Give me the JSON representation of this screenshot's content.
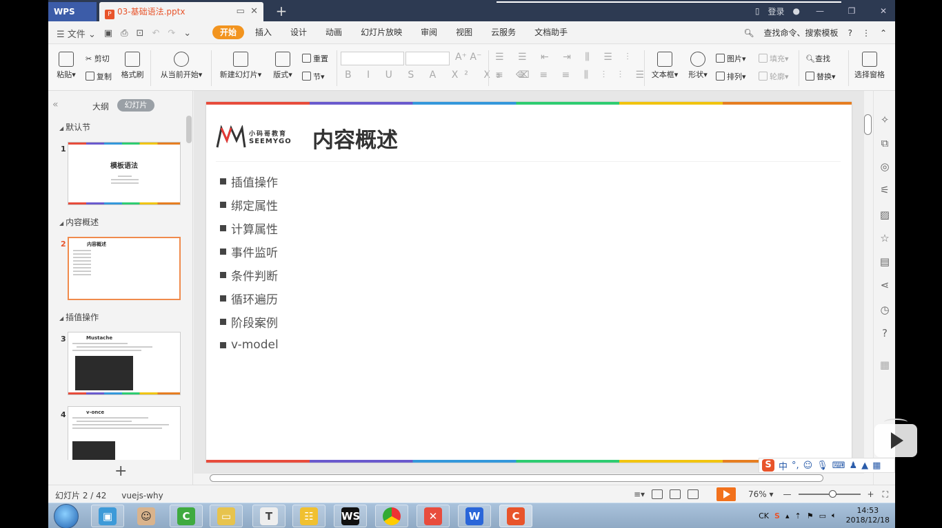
{
  "titlebar": {
    "app_tab": "WPS",
    "doc_tab": "03-基础语法.pptx",
    "new_tab": "+",
    "login": "登录"
  },
  "menubar": {
    "file": "文件",
    "tabs": [
      "开始",
      "插入",
      "设计",
      "动画",
      "幻灯片放映",
      "审阅",
      "视图",
      "云服务",
      "文档助手"
    ],
    "search": "查找命令、搜索模板"
  },
  "ribbon": {
    "paste": "粘贴",
    "cut": "剪切",
    "copy": "复制",
    "format_painter": "格式刷",
    "from_current": "从当前开始",
    "new_slide": "新建幻灯片",
    "layout": "版式",
    "reset": "重置",
    "section": "节",
    "textbox": "文本框",
    "shape": "形状",
    "picture": "图片",
    "arrange": "排列",
    "fill": "填充",
    "outline": "轮廓",
    "find": "查找",
    "replace": "替换",
    "select_pane": "选择窗格"
  },
  "leftpanel": {
    "outline_tab": "大纲",
    "slides_tab": "幻灯片",
    "sections": [
      {
        "label": "默认节"
      },
      {
        "label": "内容概述"
      },
      {
        "label": "插值操作"
      }
    ],
    "thumbs": [
      {
        "num": "1",
        "title": "模板语法"
      },
      {
        "num": "2",
        "title": "内容概述"
      },
      {
        "num": "3",
        "title": "Mustache"
      },
      {
        "num": "4",
        "title": "v-once"
      }
    ],
    "add": "+"
  },
  "slide": {
    "logo_cn": "小码哥教育",
    "logo_en": "SEEMYGO",
    "title": "内容概述",
    "bullets": [
      "插值操作",
      "绑定属性",
      "计算属性",
      "事件监听",
      "条件判断",
      "循环遍历",
      "阶段案例",
      "v-model"
    ]
  },
  "ime": {
    "lang": "中"
  },
  "statusbar": {
    "slide_pos": "幻灯片 2 / 42",
    "theme": "vuejs-why",
    "zoom": "76%"
  },
  "taskbar": {
    "tray_lang": "CK",
    "time": "14:53",
    "date": "2018/12/18"
  }
}
